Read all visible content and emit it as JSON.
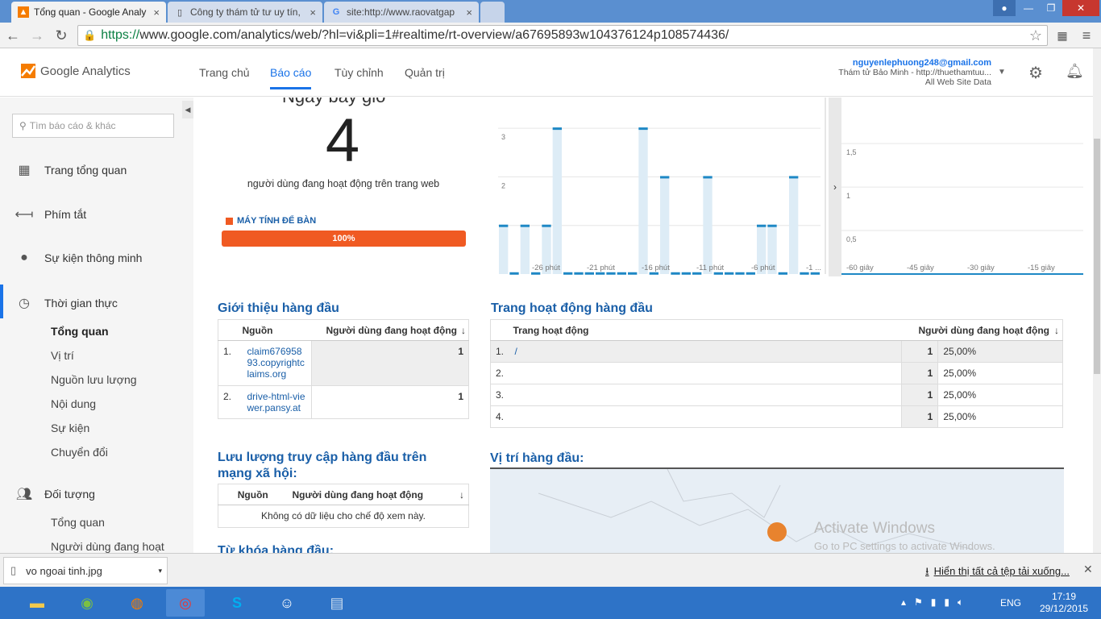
{
  "browser": {
    "tabs": [
      {
        "title": "Tổng quan - Google Analy",
        "active": true
      },
      {
        "title": "Công ty thám tử tư uy tín,"
      },
      {
        "title": "site:http://www.raovatgap"
      }
    ],
    "url_scheme": "https://",
    "url_rest": "www.google.com/analytics/web/?hl=vi&pli=1#realtime/rt-overview/a67695893w104376124p108574436/"
  },
  "ga": {
    "logo": "Google Analytics",
    "nav": [
      "Trang chủ",
      "Báo cáo",
      "Tùy chỉnh",
      "Quản trị"
    ],
    "account": {
      "email": "nguyenlephuong248@gmail.com",
      "property": "Thám tử Bảo Minh - http://thuethamtuu...",
      "view": "All Web Site Data"
    }
  },
  "sidebar": {
    "search_placeholder": "Tìm báo cáo & khác",
    "items": [
      {
        "label": "Trang tổng quan",
        "icon": "grid-icon"
      },
      {
        "label": "Phím tắt",
        "icon": "arrow-left-icon"
      },
      {
        "label": "Sự kiện thông minh",
        "icon": "lightbulb-icon"
      },
      {
        "label": "Thời gian thực",
        "icon": "clock-icon"
      },
      {
        "label": "Đối tượng",
        "icon": "people-icon"
      }
    ],
    "realtime_sub": [
      "Tổng quan",
      "Vị trí",
      "Nguồn lưu lượng",
      "Nội dung",
      "Sự kiện",
      "Chuyển đổi"
    ],
    "audience_sub": [
      "Tổng quan",
      "Người dùng đang hoạt"
    ]
  },
  "overview": {
    "partial_heading": "Ngay bay gio",
    "active_count": "4",
    "active_caption": "người dùng đang hoạt động trên trang web",
    "device_label": "MÁY TÍNH ĐỂ BÀN",
    "device_pct": "100%",
    "device_fraction": 1.0
  },
  "chart_minutes": {
    "type": "bar",
    "yticks": [
      "3",
      "2",
      "1"
    ],
    "xticks": [
      "-26 phút",
      "-21 phút",
      "-16 phút",
      "-11 phút",
      "-6 phút",
      "-1 ..."
    ],
    "values": [
      1,
      0,
      1,
      0,
      1,
      3,
      0,
      0,
      0,
      0,
      0,
      0,
      0,
      3,
      0,
      2,
      0,
      0,
      0,
      2,
      0,
      0,
      0,
      0,
      1,
      1,
      0,
      2,
      0,
      0
    ],
    "ylim": [
      0,
      3
    ]
  },
  "chart_seconds": {
    "type": "bar",
    "yticks": [
      "1,5",
      "1",
      "0,5"
    ],
    "xticks": [
      "-60 giây",
      "-45 giây",
      "-30 giây",
      "-15 giây"
    ],
    "ylim": [
      0,
      2
    ]
  },
  "referrals": {
    "title": "Giới thiệu hàng đầu",
    "col_source": "Nguồn",
    "col_users": "Người dùng đang hoạt động",
    "rows": [
      {
        "n": "1.",
        "source": "claim67695893.copyrightclaims.org",
        "users": "1"
      },
      {
        "n": "2.",
        "source": "drive-html-viewer.pansy.at",
        "users": "1"
      }
    ]
  },
  "social": {
    "title": "Lưu lượng truy cập hàng đầu trên mạng xã hội:",
    "col_source": "Nguồn",
    "col_users": "Người dùng đang hoạt động",
    "empty": "Không có dữ liệu cho chế độ xem này."
  },
  "keywords_partial": "Từ khóa hàng đầu:",
  "pages": {
    "title": "Trang hoạt động hàng đầu",
    "col_page": "Trang hoạt động",
    "col_users": "Người dùng đang hoạt động",
    "rows": [
      {
        "n": "1.",
        "page": "/",
        "users": "1",
        "pct": "25,00%"
      },
      {
        "n": "2.",
        "page": "",
        "users": "1",
        "pct": "25,00%"
      },
      {
        "n": "3.",
        "page": "",
        "users": "1",
        "pct": "25,00%"
      },
      {
        "n": "4.",
        "page": "",
        "users": "1",
        "pct": "25,00%"
      }
    ]
  },
  "locations": {
    "title": "Vị trí hàng đầu:"
  },
  "watermark": {
    "line1": "Activate Windows",
    "line2": "Go to PC settings to activate Windows."
  },
  "download": {
    "file": "vo ngoai tinh.jpg",
    "show_all": "Hiển thị tất cả tệp tải xuống..."
  },
  "taskbar": {
    "lang": "ENG",
    "time": "17:19",
    "date": "29/12/2015"
  }
}
